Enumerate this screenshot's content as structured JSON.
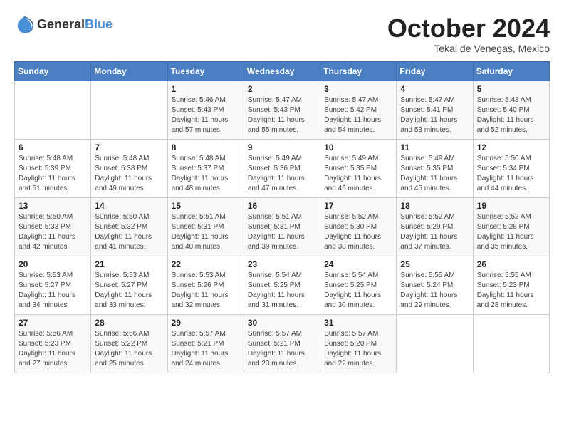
{
  "logo": {
    "general": "General",
    "blue": "Blue"
  },
  "title": "October 2024",
  "subtitle": "Tekal de Venegas, Mexico",
  "days_of_week": [
    "Sunday",
    "Monday",
    "Tuesday",
    "Wednesday",
    "Thursday",
    "Friday",
    "Saturday"
  ],
  "weeks": [
    [
      {
        "day": "",
        "info": ""
      },
      {
        "day": "",
        "info": ""
      },
      {
        "day": "1",
        "info": "Sunrise: 5:46 AM\nSunset: 5:43 PM\nDaylight: 11 hours and 57 minutes."
      },
      {
        "day": "2",
        "info": "Sunrise: 5:47 AM\nSunset: 5:43 PM\nDaylight: 11 hours and 55 minutes."
      },
      {
        "day": "3",
        "info": "Sunrise: 5:47 AM\nSunset: 5:42 PM\nDaylight: 11 hours and 54 minutes."
      },
      {
        "day": "4",
        "info": "Sunrise: 5:47 AM\nSunset: 5:41 PM\nDaylight: 11 hours and 53 minutes."
      },
      {
        "day": "5",
        "info": "Sunrise: 5:48 AM\nSunset: 5:40 PM\nDaylight: 11 hours and 52 minutes."
      }
    ],
    [
      {
        "day": "6",
        "info": "Sunrise: 5:48 AM\nSunset: 5:39 PM\nDaylight: 11 hours and 51 minutes."
      },
      {
        "day": "7",
        "info": "Sunrise: 5:48 AM\nSunset: 5:38 PM\nDaylight: 11 hours and 49 minutes."
      },
      {
        "day": "8",
        "info": "Sunrise: 5:48 AM\nSunset: 5:37 PM\nDaylight: 11 hours and 48 minutes."
      },
      {
        "day": "9",
        "info": "Sunrise: 5:49 AM\nSunset: 5:36 PM\nDaylight: 11 hours and 47 minutes."
      },
      {
        "day": "10",
        "info": "Sunrise: 5:49 AM\nSunset: 5:35 PM\nDaylight: 11 hours and 46 minutes."
      },
      {
        "day": "11",
        "info": "Sunrise: 5:49 AM\nSunset: 5:35 PM\nDaylight: 11 hours and 45 minutes."
      },
      {
        "day": "12",
        "info": "Sunrise: 5:50 AM\nSunset: 5:34 PM\nDaylight: 11 hours and 44 minutes."
      }
    ],
    [
      {
        "day": "13",
        "info": "Sunrise: 5:50 AM\nSunset: 5:33 PM\nDaylight: 11 hours and 42 minutes."
      },
      {
        "day": "14",
        "info": "Sunrise: 5:50 AM\nSunset: 5:32 PM\nDaylight: 11 hours and 41 minutes."
      },
      {
        "day": "15",
        "info": "Sunrise: 5:51 AM\nSunset: 5:31 PM\nDaylight: 11 hours and 40 minutes."
      },
      {
        "day": "16",
        "info": "Sunrise: 5:51 AM\nSunset: 5:31 PM\nDaylight: 11 hours and 39 minutes."
      },
      {
        "day": "17",
        "info": "Sunrise: 5:52 AM\nSunset: 5:30 PM\nDaylight: 11 hours and 38 minutes."
      },
      {
        "day": "18",
        "info": "Sunrise: 5:52 AM\nSunset: 5:29 PM\nDaylight: 11 hours and 37 minutes."
      },
      {
        "day": "19",
        "info": "Sunrise: 5:52 AM\nSunset: 5:28 PM\nDaylight: 11 hours and 35 minutes."
      }
    ],
    [
      {
        "day": "20",
        "info": "Sunrise: 5:53 AM\nSunset: 5:27 PM\nDaylight: 11 hours and 34 minutes."
      },
      {
        "day": "21",
        "info": "Sunrise: 5:53 AM\nSunset: 5:27 PM\nDaylight: 11 hours and 33 minutes."
      },
      {
        "day": "22",
        "info": "Sunrise: 5:53 AM\nSunset: 5:26 PM\nDaylight: 11 hours and 32 minutes."
      },
      {
        "day": "23",
        "info": "Sunrise: 5:54 AM\nSunset: 5:25 PM\nDaylight: 11 hours and 31 minutes."
      },
      {
        "day": "24",
        "info": "Sunrise: 5:54 AM\nSunset: 5:25 PM\nDaylight: 11 hours and 30 minutes."
      },
      {
        "day": "25",
        "info": "Sunrise: 5:55 AM\nSunset: 5:24 PM\nDaylight: 11 hours and 29 minutes."
      },
      {
        "day": "26",
        "info": "Sunrise: 5:55 AM\nSunset: 5:23 PM\nDaylight: 11 hours and 28 minutes."
      }
    ],
    [
      {
        "day": "27",
        "info": "Sunrise: 5:56 AM\nSunset: 5:23 PM\nDaylight: 11 hours and 27 minutes."
      },
      {
        "day": "28",
        "info": "Sunrise: 5:56 AM\nSunset: 5:22 PM\nDaylight: 11 hours and 25 minutes."
      },
      {
        "day": "29",
        "info": "Sunrise: 5:57 AM\nSunset: 5:21 PM\nDaylight: 11 hours and 24 minutes."
      },
      {
        "day": "30",
        "info": "Sunrise: 5:57 AM\nSunset: 5:21 PM\nDaylight: 11 hours and 23 minutes."
      },
      {
        "day": "31",
        "info": "Sunrise: 5:57 AM\nSunset: 5:20 PM\nDaylight: 11 hours and 22 minutes."
      },
      {
        "day": "",
        "info": ""
      },
      {
        "day": "",
        "info": ""
      }
    ]
  ]
}
